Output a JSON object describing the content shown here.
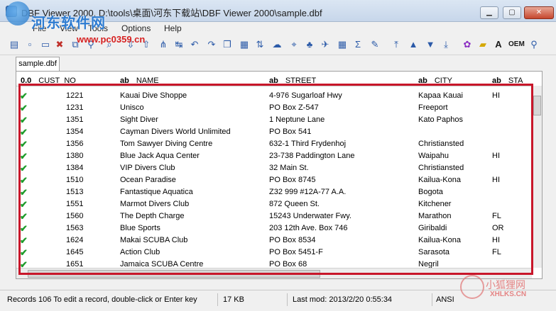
{
  "window": {
    "title": "DBF Viewer 2000, D:\\tools\\桌面\\河东下载站\\DBF Viewer 2000\\sample.dbf",
    "minimize": "▁",
    "maximize": "▢",
    "close": "✕"
  },
  "menu": [
    "File",
    "View",
    "Tools",
    "Options",
    "Help"
  ],
  "toolbar_icons": [
    "open-folder-icon",
    "new-file-icon",
    "delete-icon",
    "copy-icon",
    "link-icon",
    "find-icon",
    "import-icon",
    "export-icon",
    "filter-icon",
    "replace-icon",
    "undo-icon",
    "redo-icon",
    "duplicate-icon",
    "calculator-icon",
    "sort-icon",
    "comment-icon",
    "pin-icon",
    "tree-icon",
    "plane-icon",
    "grid-icon",
    "sum-icon",
    "brush-icon",
    "first-icon",
    "prev-icon",
    "next-icon",
    "last-icon",
    "palette-icon",
    "note-icon",
    "font-icon",
    "oem-icon",
    "pin2-icon"
  ],
  "tab": "sample.dbf",
  "columns": [
    {
      "type": "0.0",
      "label": "CUST_NO"
    },
    {
      "type": "ab",
      "label": "NAME"
    },
    {
      "type": "ab",
      "label": "STREET"
    },
    {
      "type": "ab",
      "label": "CITY"
    },
    {
      "type": "ab",
      "label": "STA"
    }
  ],
  "rows": [
    {
      "cust_no": "1221",
      "name": "Kauai Dive Shoppe",
      "street": "4-976 Sugarloaf Hwy",
      "city": "Kapaa Kauai",
      "state": "HI"
    },
    {
      "cust_no": "1231",
      "name": "Unisco",
      "street": "PO Box Z-547",
      "city": "Freeport",
      "state": ""
    },
    {
      "cust_no": "1351",
      "name": "Sight Diver",
      "street": "1 Neptune Lane",
      "city": "Kato Paphos",
      "state": ""
    },
    {
      "cust_no": "1354",
      "name": "Cayman Divers World Unlimited",
      "street": "PO Box 541",
      "city": "",
      "state": ""
    },
    {
      "cust_no": "1356",
      "name": "Tom Sawyer Diving Centre",
      "street": "632-1 Third Frydenhoj",
      "city": "Christiansted",
      "state": ""
    },
    {
      "cust_no": "1380",
      "name": "Blue Jack Aqua Center",
      "street": "23-738 Paddington Lane",
      "city": "Waipahu",
      "state": "HI"
    },
    {
      "cust_no": "1384",
      "name": "VIP Divers Club",
      "street": "32 Main St.",
      "city": "Christiansted",
      "state": ""
    },
    {
      "cust_no": "1510",
      "name": "Ocean Paradise",
      "street": "PO Box 8745",
      "city": "Kailua-Kona",
      "state": "HI"
    },
    {
      "cust_no": "1513",
      "name": "Fantastique Aquatica",
      "street": "Z32 999 #12A-77 A.A.",
      "city": "Bogota",
      "state": ""
    },
    {
      "cust_no": "1551",
      "name": "Marmot Divers Club",
      "street": "872 Queen St.",
      "city": "Kitchener",
      "state": ""
    },
    {
      "cust_no": "1560",
      "name": "The Depth Charge",
      "street": "15243 Underwater Fwy.",
      "city": "Marathon",
      "state": "FL"
    },
    {
      "cust_no": "1563",
      "name": "Blue Sports",
      "street": "203 12th Ave. Box 746",
      "city": "Giribaldi",
      "state": "OR"
    },
    {
      "cust_no": "1624",
      "name": "Makai SCUBA Club",
      "street": "PO Box 8534",
      "city": "Kailua-Kona",
      "state": "HI"
    },
    {
      "cust_no": "1645",
      "name": "Action Club",
      "street": "PO Box 5451-F",
      "city": "Sarasota",
      "state": "FL"
    },
    {
      "cust_no": "1651",
      "name": "Jamaica SCUBA Centre",
      "street": "PO Box 68",
      "city": "Negril",
      "state": ""
    }
  ],
  "row_marker": "✔",
  "status": {
    "records": "Records 106 To edit a record, double-click or Enter key",
    "size": "17 KB",
    "modified": "Last mod: 2013/2/20 0:55:34",
    "encoding": "ANSI"
  },
  "watermarks": {
    "top_text": "河东软件网",
    "top_url": "www.pc0359.cn",
    "bottom_text": "小狐狸网",
    "bottom_url": "XHLKS.CN"
  },
  "colors": {
    "highlight_box": "#c8162a",
    "check": "#1e9a2a"
  }
}
